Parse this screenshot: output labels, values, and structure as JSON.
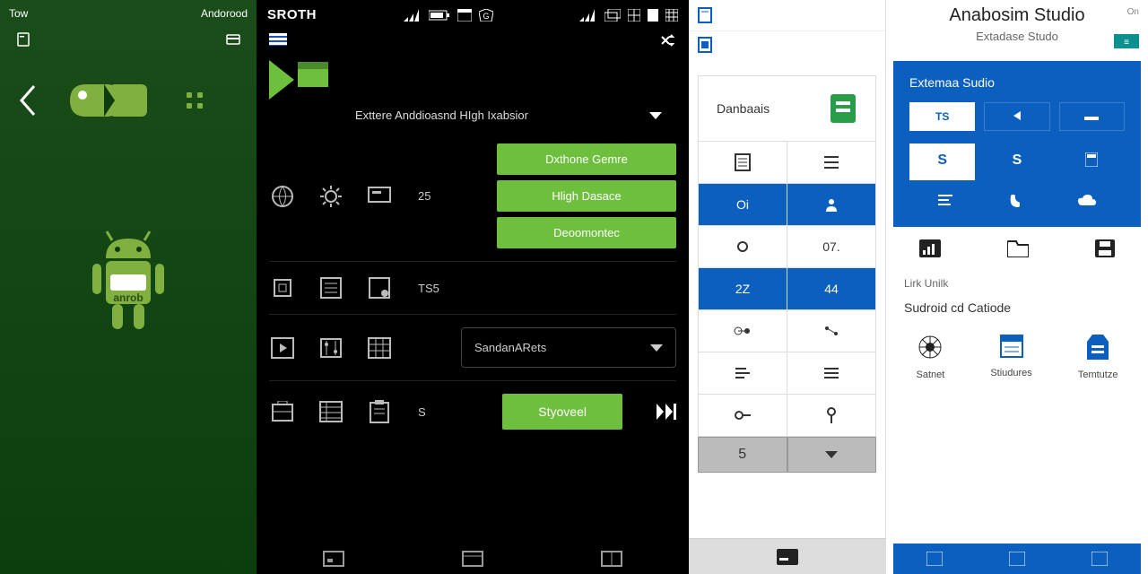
{
  "panel1": {
    "topLeft": "Tow",
    "topRight": "Andorood",
    "botLabel": "anrob"
  },
  "panel2": {
    "title": "SROTH",
    "dropdown1": "Exttere Anddioasnd HIgh Ixabsior",
    "row1_num": "25",
    "btn1": "Dxthone Gemre",
    "btn2": "Hligh Dasace",
    "btn3": "Deoomontec",
    "row2_num": "TS5",
    "dropdown2": "SandanARets",
    "row4_s": "S",
    "runBtn": "Styoveel"
  },
  "panel3": {
    "header": "Danbaais",
    "cells": {
      "r2a": "Oi",
      "r3b": "07.",
      "r4a": "2Z",
      "r4b": "44",
      "inputVal": "5"
    }
  },
  "panel4": {
    "title": "Anabosim Studio",
    "subtitle": "Extadase Studo",
    "on": "On",
    "blueTitle": "Extemaa Sudio",
    "tab1": "TS",
    "s1": "S",
    "s2": "S",
    "link": "Lirk Unilk",
    "section": "Sudroid cd Catiode",
    "card1": "Satnet",
    "card2": "Stiudures",
    "card3": "Temtutze"
  }
}
